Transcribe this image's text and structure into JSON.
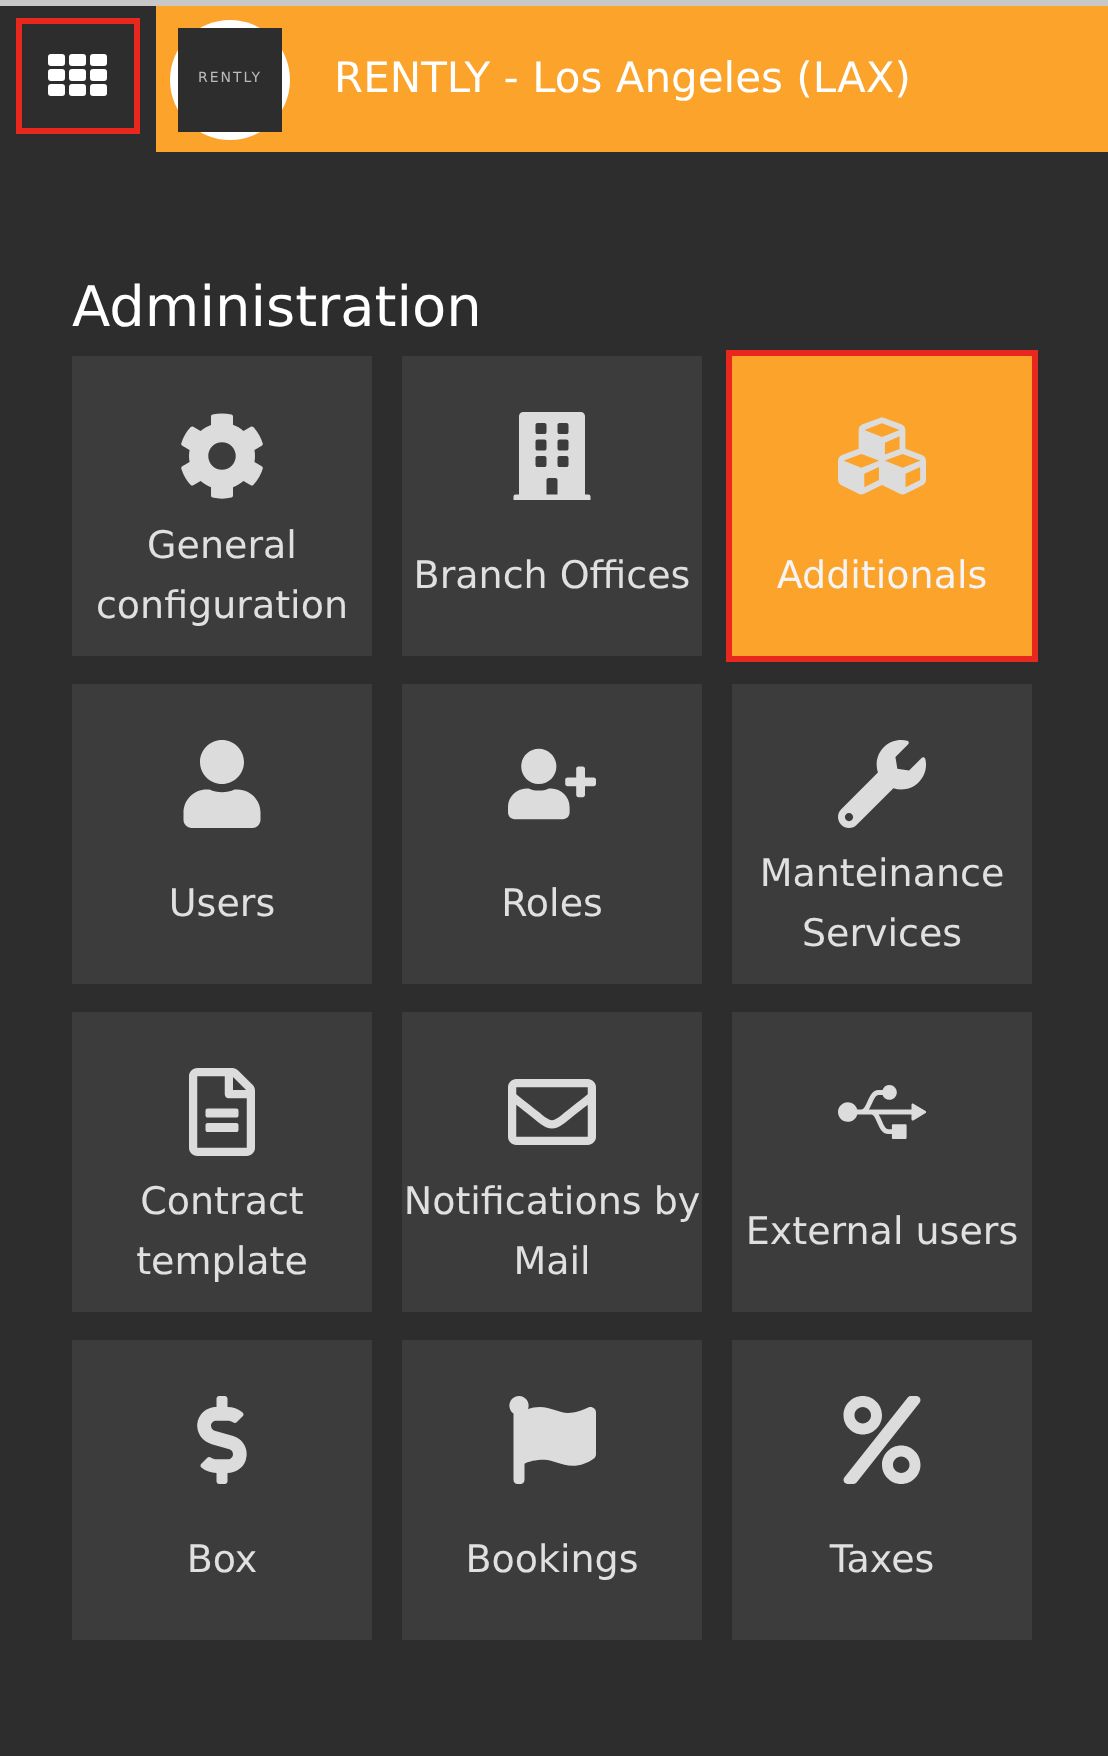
{
  "header": {
    "menu_button": {
      "highlighted": true
    },
    "logo_text": "RENTLY",
    "title": "RENTLY - Los Angeles (LAX)"
  },
  "section": {
    "title": "Administration",
    "tiles": [
      {
        "label": "General configuration",
        "selected": false,
        "highlighted": false
      },
      {
        "label": "Branch Offices",
        "selected": false,
        "highlighted": false
      },
      {
        "label": "Additionals",
        "selected": true,
        "highlighted": true
      },
      {
        "label": "Users",
        "selected": false,
        "highlighted": false
      },
      {
        "label": "Roles",
        "selected": false,
        "highlighted": false
      },
      {
        "label": "Manteinance Services",
        "selected": false,
        "highlighted": false
      },
      {
        "label": "Contract template",
        "selected": false,
        "highlighted": false
      },
      {
        "label": "Notifications by Mail",
        "selected": false,
        "highlighted": false
      },
      {
        "label": "External users",
        "selected": false,
        "highlighted": false
      },
      {
        "label": "Box",
        "selected": false,
        "highlighted": false
      },
      {
        "label": "Bookings",
        "selected": false,
        "highlighted": false
      },
      {
        "label": "Taxes",
        "selected": false,
        "highlighted": false
      }
    ]
  }
}
